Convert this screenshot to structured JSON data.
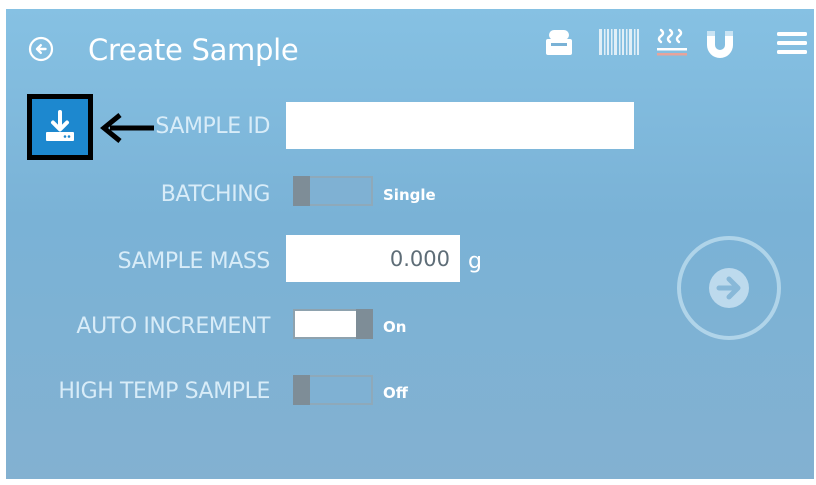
{
  "header": {
    "title": "Create Sample"
  },
  "icons": {
    "back": "back-arrow-circle-icon",
    "import": "download-import-icon",
    "printer": "printer-icon",
    "barcode": "barcode-icon",
    "heater": "heater-icon",
    "magnet": "magnet-icon",
    "menu": "hamburger-menu-icon",
    "next": "next-arrow-circle-icon"
  },
  "form": {
    "sample_id": {
      "label": "SAMPLE ID",
      "value": ""
    },
    "batching": {
      "label": "BATCHING",
      "state": "Single"
    },
    "sample_mass": {
      "label": "SAMPLE MASS",
      "value": "0.000",
      "unit": "g"
    },
    "auto_increment": {
      "label": "AUTO INCREMENT",
      "state": "On"
    },
    "high_temp_sample": {
      "label": "HIGH TEMP SAMPLE",
      "state": "Off"
    }
  },
  "colors": {
    "accent_blue": "#1d88cf",
    "background_top": "#86c1e3",
    "label_text": "#d8ecf8"
  }
}
